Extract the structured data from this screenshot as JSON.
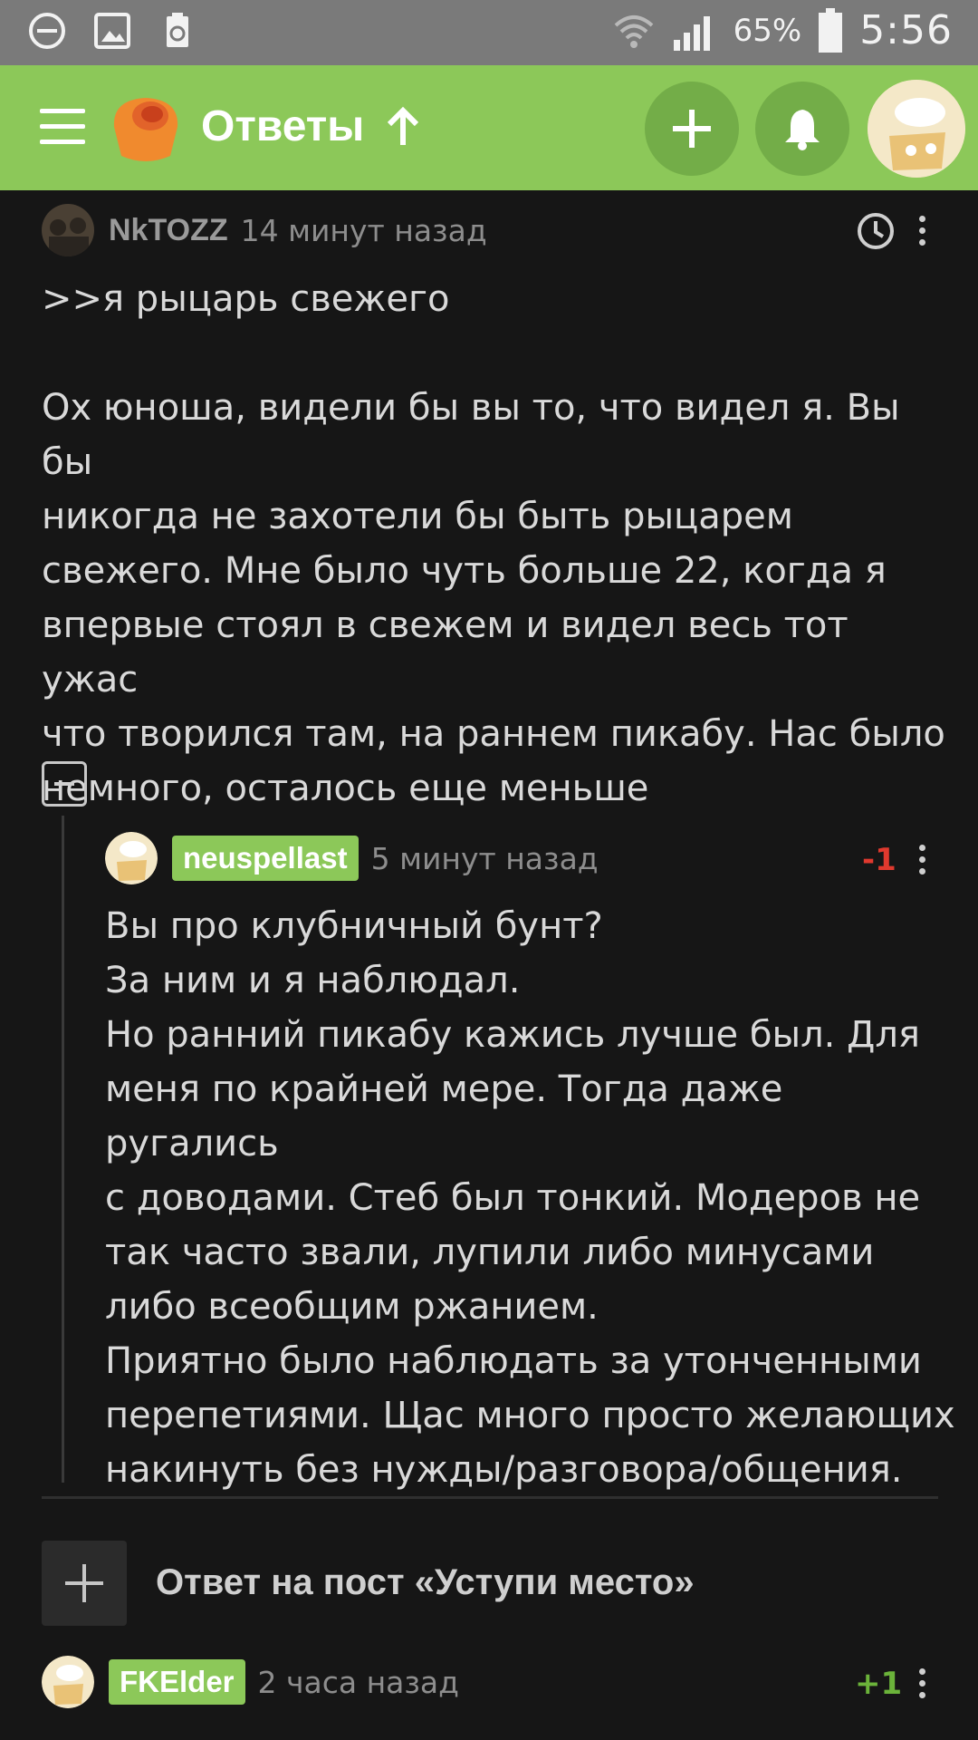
{
  "status_bar": {
    "battery_pct": "65%",
    "time": "5:56",
    "icons": [
      "do-not-disturb-icon",
      "gallery-icon",
      "recycle-icon",
      "wifi-icon",
      "signal-icon",
      "battery-icon"
    ]
  },
  "app_bar": {
    "title": "Ответы",
    "icons": [
      "menu-icon",
      "cupcake-logo",
      "arrow-up-icon",
      "plus-icon",
      "bell-icon",
      "avatar"
    ],
    "accent_color": "#8cc859"
  },
  "comments": [
    {
      "author": "NkTOZZ",
      "time_ago": "14 минут назад",
      "text": ">>я рыцарь свежего\n\nОх юноша, видели бы вы то, что видел я. Вы бы\nникогда не захотели бы быть рыцарем\nсвежего. Мне было чуть больше 22, когда я\nвпервые стоял в свежем и видел весь тот ужас\nчто творился там, на раннем пикабу. Нас было\nнемного, осталось еще меньше"
    },
    {
      "author": "neuspellast",
      "time_ago": "5 минут назад",
      "rating": "-1",
      "rating_color": "#e0392e",
      "text": "Вы про клубничный бунт?\nЗа ним и я наблюдал.\nНо ранний пикабу кажись лучше был. Для\nменя по крайней мере. Тогда даже ругались\nс доводами. Стеб был тонкий. Модеров не\nтак часто звали, лупили либо минусами\nлибо всеобщим ржанием.\nПриятно было наблюдать за утонченными\nперепетиями. Щас много просто желающих\nнакинуть без нужды/разговора/общения."
    },
    {
      "author": "FKElder",
      "time_ago": "2 часа назад",
      "rating": "+1",
      "rating_color": "#6bb33a"
    }
  ],
  "reply_to_post": "Ответ на пост «Уступи место»"
}
